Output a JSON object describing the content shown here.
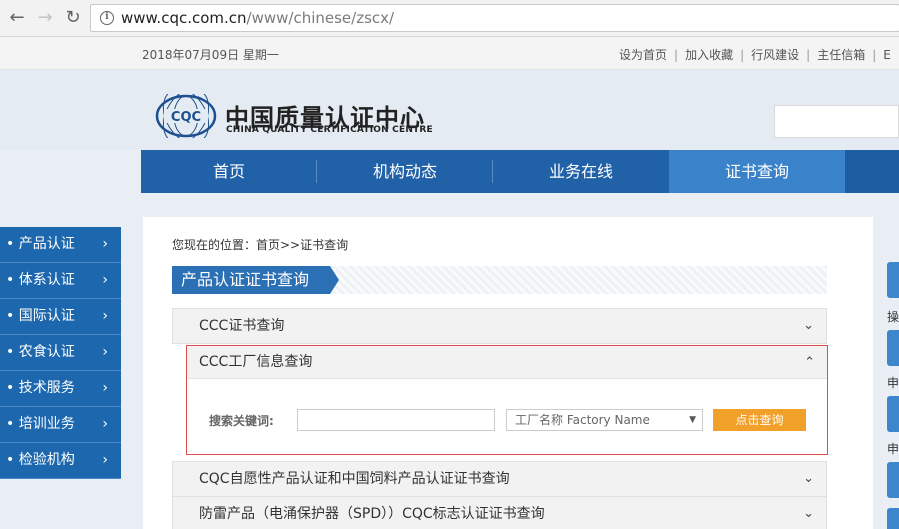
{
  "browser": {
    "url_host": "www.cqc.com.cn",
    "url_path": "/www/chinese/zscx/"
  },
  "topbar": {
    "date": "2018年07月09日  星期一",
    "links": [
      "设为首页",
      "加入收藏",
      "行风建设",
      "主任信箱"
    ],
    "last_sep": "|",
    "cut_link": "E"
  },
  "header": {
    "logo_text": "CQC",
    "name_cn": "中国质量认证中心",
    "name_en": "CHINA QUALITY CERTIFICATION CENTRE"
  },
  "main_nav": [
    "首页",
    "机构动态",
    "业务在线",
    "证书查询"
  ],
  "sidebar": [
    "产品认证",
    "体系认证",
    "国际认证",
    "农食认证",
    "技术服务",
    "培训业务",
    "检验机构"
  ],
  "content": {
    "breadcrumb": "您现在的位置：首页>>证书查询",
    "section_title": "产品认证证书查询",
    "accordion": {
      "ccc": "CCC证书查询",
      "factory": "CCC工厂信息查询",
      "voluntary": "CQC自愿性产品认证和中国饲料产品认证证书查询",
      "spd": "防雷产品（电涌保护器（SPD））CQC标志认证证书查询"
    },
    "search": {
      "label": "搜索关键词:",
      "keyword_value": "",
      "type_selected": "工厂名称 Factory Name",
      "button": "点击查询"
    }
  },
  "right_labels": [
    "操",
    "申",
    "申"
  ],
  "colors": {
    "nav_blue": "#2161a8",
    "nav_active": "#3a83cb",
    "sidebar_blue": "#1c67ae",
    "button_orange": "#f1a02a",
    "open_border": "#e04a4a"
  }
}
